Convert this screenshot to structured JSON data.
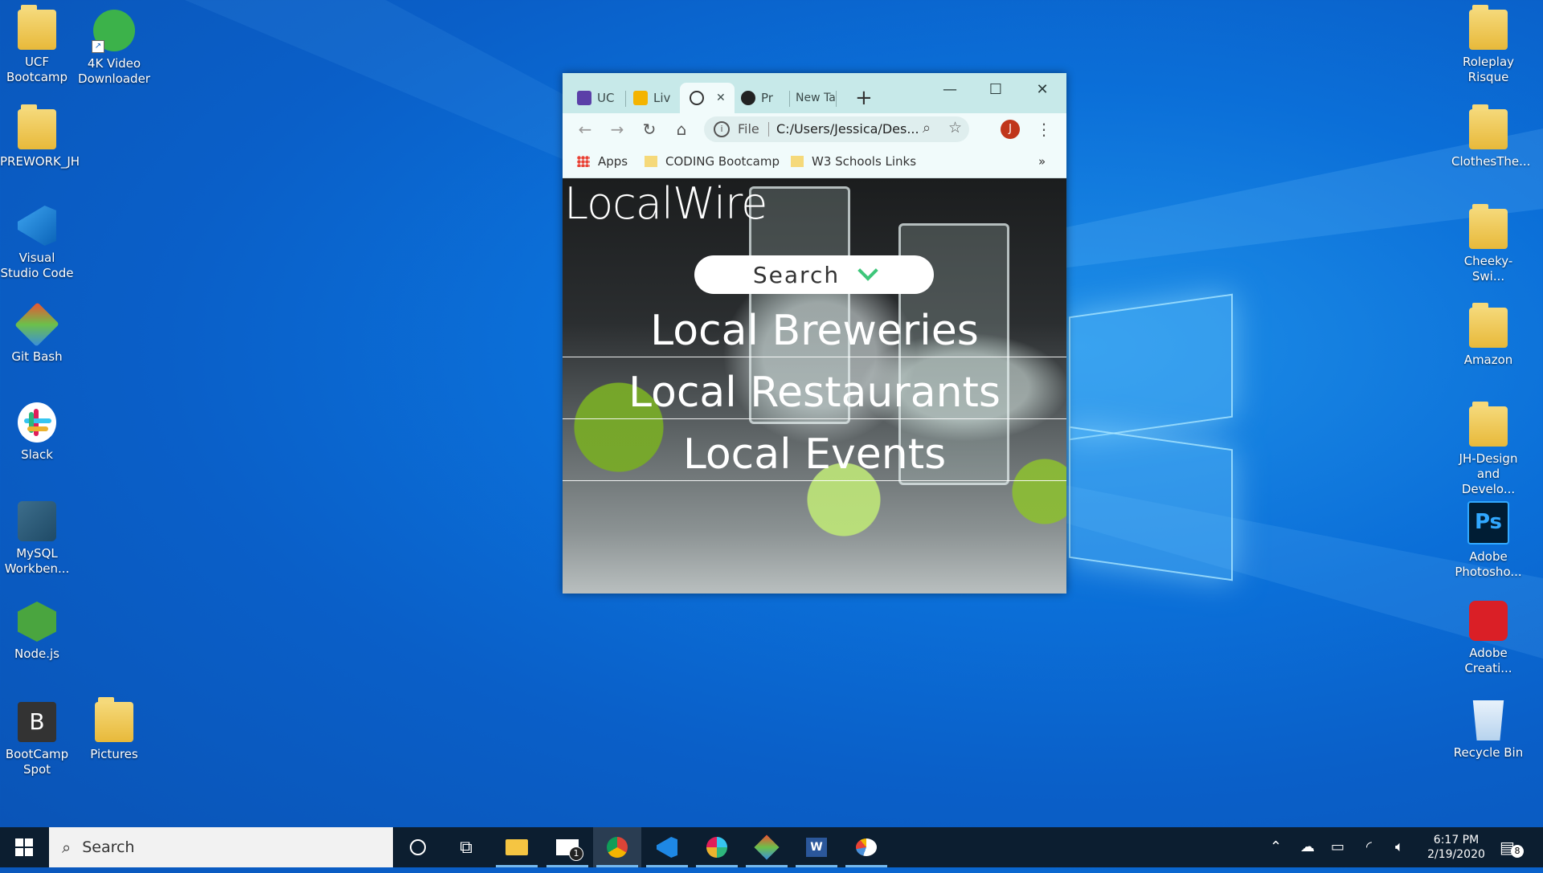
{
  "desktop": {
    "left_icons": [
      {
        "label": "UCF Bootcamp",
        "icon": "folder-icon"
      },
      {
        "label": "4K Video Downloader",
        "icon": "downloader-icon"
      },
      {
        "label": "PREWORK_JH",
        "icon": "folder-icon"
      },
      {
        "label": "Visual Studio Code",
        "icon": "vscode-icon"
      },
      {
        "label": "Git Bash",
        "icon": "git-icon"
      },
      {
        "label": "Slack",
        "icon": "slack-icon"
      },
      {
        "label": "MySQL Workben...",
        "icon": "mysql-icon"
      },
      {
        "label": "Node.js",
        "icon": "nodejs-icon"
      },
      {
        "label": "BootCamp Spot",
        "icon": "bootcamp-icon"
      },
      {
        "label": "Pictures",
        "icon": "folder-icon"
      }
    ],
    "right_icons": [
      {
        "label": "Roleplay Risque",
        "icon": "folder-icon"
      },
      {
        "label": "ClothesThe...",
        "icon": "folder-icon"
      },
      {
        "label": "Cheeky-Swi...",
        "icon": "folder-icon"
      },
      {
        "label": "Amazon",
        "icon": "folder-icon"
      },
      {
        "label": "JH-Design and Develo...",
        "icon": "folder-icon"
      },
      {
        "label": "Adobe Photosho...",
        "icon": "photoshop-icon"
      },
      {
        "label": "Adobe Creati...",
        "icon": "creative-cloud-icon"
      },
      {
        "label": "Recycle Bin",
        "icon": "recycle-bin-icon"
      }
    ]
  },
  "browser": {
    "tabs": [
      {
        "label": "UC",
        "icon": "list-icon",
        "color": "#5b3fa8"
      },
      {
        "label": "Liv",
        "icon": "slides-icon",
        "color": "#f4b400"
      },
      {
        "label": "",
        "icon": "globe-icon",
        "active": true
      },
      {
        "label": "Pr",
        "icon": "github-icon"
      },
      {
        "label": "New Ta",
        "icon": ""
      }
    ],
    "new_tab": "+",
    "window_controls": {
      "minimize": "—",
      "maximize": "☐",
      "close": "✕"
    },
    "address": {
      "scheme_label": "File",
      "url": "C:/Users/Jessica/Des...",
      "profile_initial": "J"
    },
    "bookmarks": [
      {
        "label": "Apps",
        "icon": "apps-grid-icon"
      },
      {
        "label": "CODING Bootcamp",
        "icon": "folder-icon"
      },
      {
        "label": "W3 Schools Links",
        "icon": "folder-icon"
      }
    ],
    "bookmarks_overflow": "»"
  },
  "page": {
    "logo": "LocalWire",
    "search_label": "Search",
    "nav_links": [
      "Local Breweries",
      "Local Restaurants",
      "Local Events"
    ]
  },
  "taskbar": {
    "search_placeholder": "Search",
    "mail_badge": "1",
    "time": "6:17 PM",
    "date": "2/19/2020",
    "notifications_count": "8"
  },
  "colors": {
    "desktop_bg": "#0a6fd8",
    "tabstrip": "#c7e9e9",
    "search_chevron": "#3ec67a",
    "profile": "#c0361b"
  }
}
